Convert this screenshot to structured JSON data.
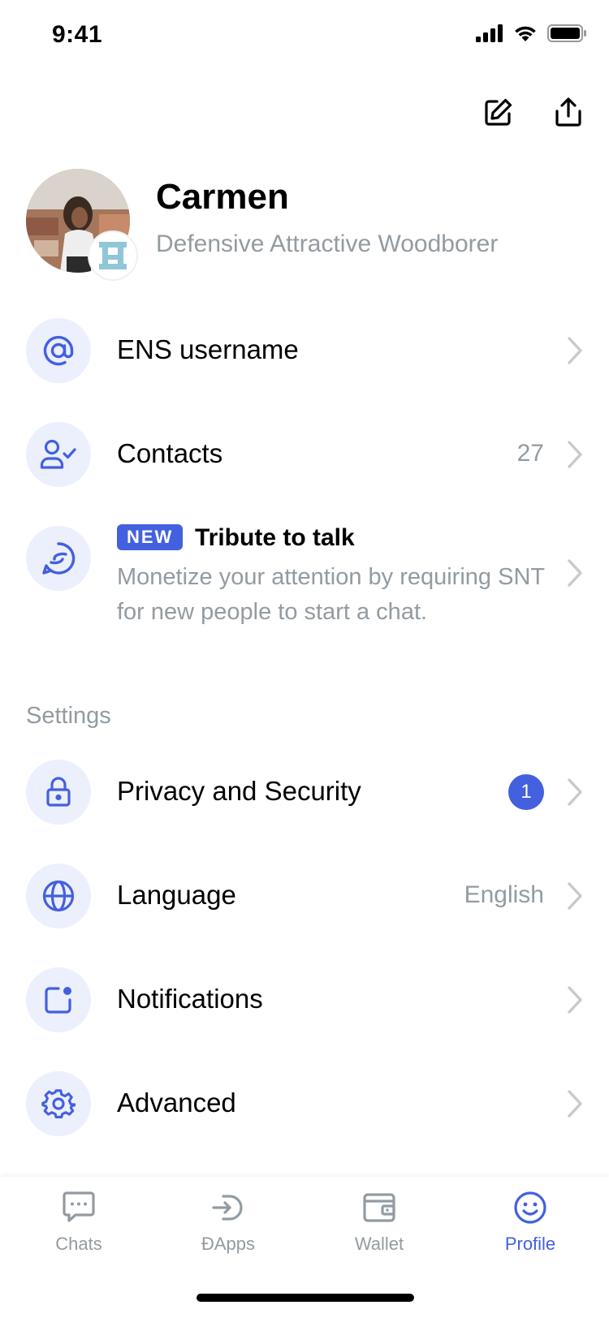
{
  "status_bar": {
    "time": "9:41"
  },
  "profile": {
    "name": "Carmen",
    "subtitle": "Defensive Attractive Woodborer"
  },
  "menu": {
    "ens": {
      "label": "ENS username",
      "icon": "at-icon"
    },
    "contacts": {
      "label": "Contacts",
      "value": "27",
      "icon": "user-check-icon"
    },
    "tribute": {
      "tag": "NEW",
      "title": "Tribute to talk",
      "description": "Monetize your attention by requiring SNT for new people to start a chat.",
      "icon": "tribute-icon"
    }
  },
  "settings": {
    "section_title": "Settings",
    "privacy": {
      "label": "Privacy and Security",
      "badge": "1",
      "icon": "lock-icon"
    },
    "language": {
      "label": "Language",
      "value": "English",
      "icon": "globe-icon"
    },
    "notifications": {
      "label": "Notifications",
      "icon": "notification-icon"
    },
    "advanced": {
      "label": "Advanced",
      "icon": "gear-icon"
    }
  },
  "tabs": [
    {
      "label": "Chats",
      "icon": "chat-icon",
      "active": false
    },
    {
      "label": "ÐApps",
      "icon": "dapps-icon",
      "active": false
    },
    {
      "label": "Wallet",
      "icon": "wallet-icon",
      "active": false
    },
    {
      "label": "Profile",
      "icon": "smile-icon",
      "active": true
    }
  ],
  "colors": {
    "accent": "#4360df",
    "icon_bg": "#eceffc",
    "muted": "#939ba1"
  }
}
